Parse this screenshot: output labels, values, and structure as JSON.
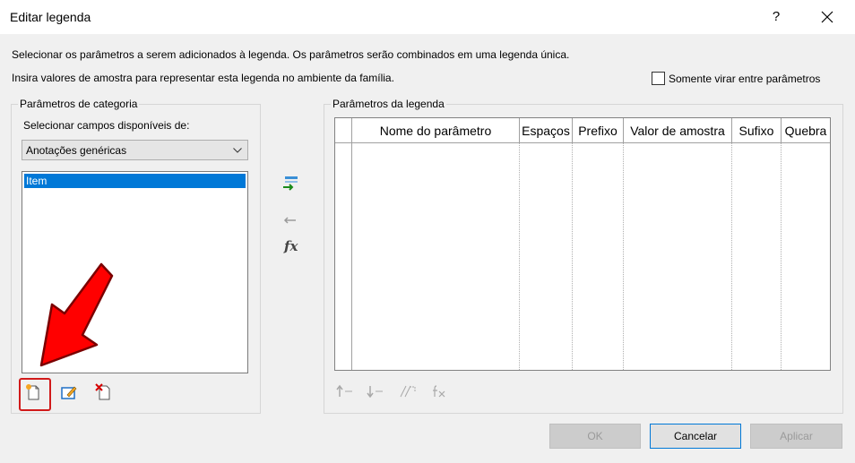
{
  "window": {
    "title": "Editar legenda",
    "help_label": "?",
    "close_label": "✕"
  },
  "instructions": {
    "line1": "Selecionar os parâmetros a serem adicionados à legenda. Os parâmetros serão combinados em uma legenda única.",
    "line2": "Insira valores de amostra para representar esta legenda no ambiente da família."
  },
  "options": {
    "flip_only_label": "Somente virar entre parâmetros",
    "flip_only_checked": false
  },
  "category_group": {
    "title": "Parâmetros de categoria",
    "select_label": "Selecionar campos disponíveis de:",
    "select_value": "Anotações genéricas",
    "items": [
      {
        "label": "Item",
        "selected": true
      }
    ]
  },
  "legend_group": {
    "title": "Parâmetros da legenda",
    "columns": [
      "Nome do parâmetro",
      "Espaços",
      "Prefixo",
      "Valor de amostra",
      "Sufixo",
      "Quebra"
    ]
  },
  "middle_buttons": {
    "add_icon": "add-parameter-icon",
    "remove_icon": "remove-parameter-icon",
    "formula_icon": "formula-icon",
    "formula_glyph": "fx"
  },
  "bottom_icons": {
    "new": "new-parameter-icon",
    "edit": "edit-parameter-icon",
    "delete": "delete-parameter-icon"
  },
  "legend_tools": {
    "move_up": "move-up-icon",
    "move_down": "move-down-icon",
    "wrap": "wrap-icon",
    "formula": "formula-icon"
  },
  "footer": {
    "ok_label": "OK",
    "cancel_label": "Cancelar",
    "apply_label": "Aplicar"
  },
  "annotation": {
    "arrow_color": "#ff0000",
    "highlight_color": "#d11a1a"
  }
}
